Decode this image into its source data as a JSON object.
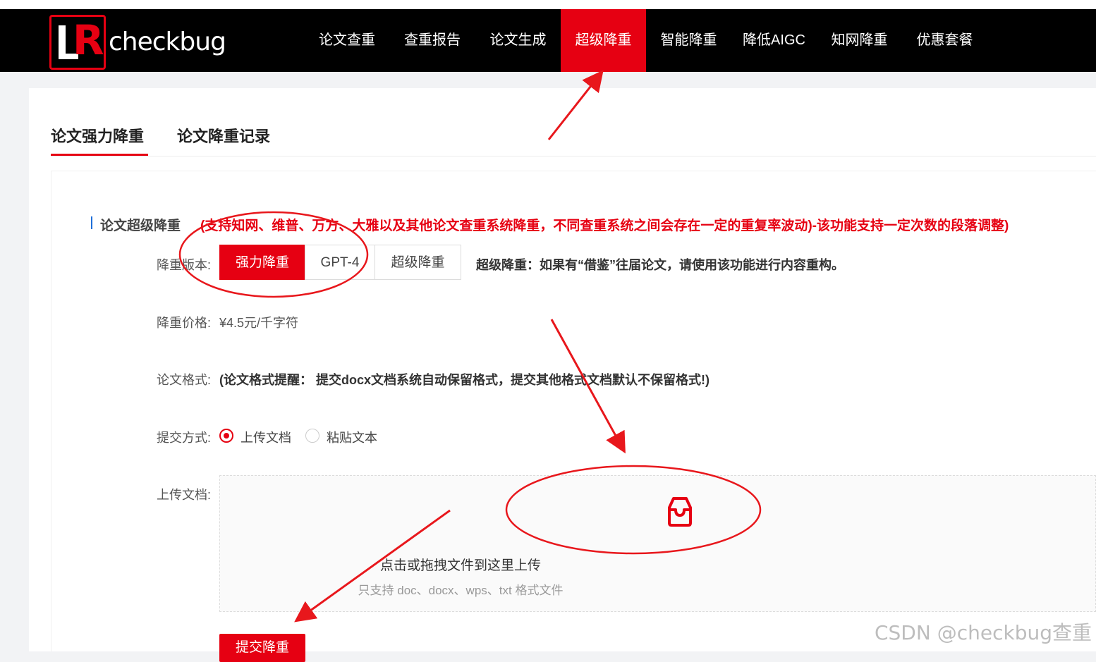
{
  "header": {
    "brand": "checkbug",
    "nav": [
      {
        "label": "论文查重",
        "active": false
      },
      {
        "label": "查重报告",
        "active": false
      },
      {
        "label": "论文生成",
        "active": false
      },
      {
        "label": "超级降重",
        "active": true
      },
      {
        "label": "智能降重",
        "active": false
      },
      {
        "label": "降低AIGC",
        "active": false
      },
      {
        "label": "知网降重",
        "active": false
      },
      {
        "label": "优惠套餐",
        "active": false
      }
    ]
  },
  "tabs": [
    {
      "label": "论文强力降重",
      "active": true
    },
    {
      "label": "论文降重记录",
      "active": false
    }
  ],
  "section": {
    "title": "论文超级降重",
    "note": "(支持知网、维普、万方、大雅以及其他论文查重系统降重，不同查重系统之间会存在一定的重复率波动)-该功能支持一定次数的段落调整)"
  },
  "form": {
    "version_label": "降重版本:",
    "versions": [
      {
        "label": "强力降重",
        "selected": true
      },
      {
        "label": "GPT-4",
        "selected": false
      },
      {
        "label": "超级降重",
        "selected": false
      }
    ],
    "version_desc": "超级降重：如果有“借鉴”往届论文，请使用该功能进行内容重构。",
    "price_label": "降重价格:",
    "price_value": "¥4.5元/千字符",
    "format_label": "论文格式:",
    "format_note": "(论文格式提醒： 提交docx文档系统自动保留格式，提交其他格式文档默认不保留格式!)",
    "submit_label": "提交方式:",
    "submit_options": [
      {
        "label": "上传文档",
        "checked": true
      },
      {
        "label": "粘贴文本",
        "checked": false
      }
    ],
    "upload_label": "上传文档:",
    "upload_main": "点击或拖拽文件到这里上传",
    "upload_sub": "只支持 doc、docx、wps、txt 格式文件",
    "submit_button": "提交降重"
  },
  "watermark": "CSDN @checkbug查重",
  "colors": {
    "accent": "#e60012",
    "nav_bg": "#000000",
    "annotation": "#e8171c"
  },
  "icons": {
    "upload": "inbox-icon",
    "logo": "checkbug-logo"
  }
}
